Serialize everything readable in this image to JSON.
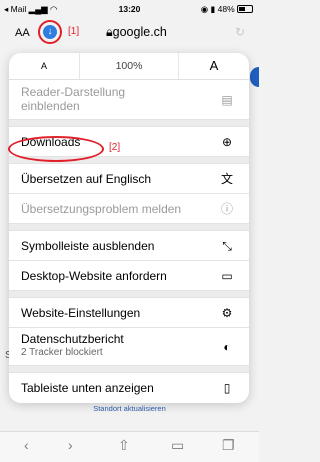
{
  "status": {
    "carrier": "◂ Mail",
    "time": "13:20",
    "battery": "48%"
  },
  "address": {
    "aa": "AA",
    "url": "google.ch",
    "annotation": "[1]"
  },
  "zoom": {
    "minus": "A",
    "value": "100%",
    "plus": "A"
  },
  "menu": {
    "reader": {
      "line1": "Reader-Darstellung",
      "line2": "einblenden"
    },
    "downloads": "Downloads",
    "downloads_annotation": "[2]",
    "translate": "Übersetzen auf Englisch",
    "translate_report": "Übersetzungsproblem melden",
    "hide_toolbar": "Symbolleiste ausblenden",
    "desktop_site": "Desktop-Website anfordern",
    "website_settings": "Website-Einstellungen",
    "privacy_report": "Datenschutzbericht",
    "privacy_sub": "2 Tracker blockiert",
    "tab_bar": "Tableiste unten anzeigen"
  },
  "background": {
    "s_letter": "S",
    "link": "Standort aktualisieren"
  },
  "colors": {
    "annotation": "#e0202a",
    "download_badge": "#2f7de1"
  }
}
